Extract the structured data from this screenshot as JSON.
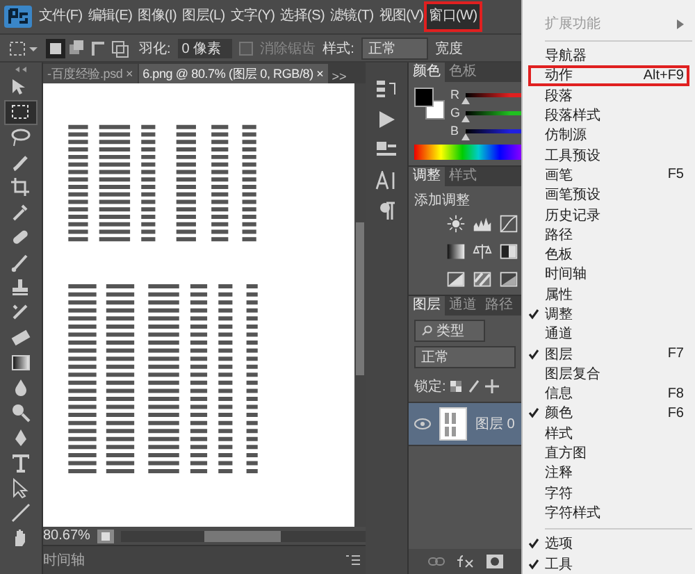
{
  "menubar": {
    "items": [
      {
        "label": "文件(F)",
        "selected": false
      },
      {
        "label": "编辑(E)",
        "selected": false
      },
      {
        "label": "图像(I)",
        "selected": false
      },
      {
        "label": "图层(L)",
        "selected": false
      },
      {
        "label": "文字(Y)",
        "selected": false
      },
      {
        "label": "选择(S)",
        "selected": false
      },
      {
        "label": "滤镜(T)",
        "selected": false
      },
      {
        "label": "视图(V)",
        "selected": false
      },
      {
        "label": "窗口(W)",
        "selected": true,
        "highlighted": true
      }
    ]
  },
  "options": {
    "feather_label": "羽化:",
    "feather_value": "0 像素",
    "antialias": {
      "label": "消除锯齿",
      "checked": false,
      "disabled": true
    },
    "style_label": "样式:",
    "style_value": "正常",
    "width_label": "宽度"
  },
  "tabs": [
    {
      "label": "-百度经验.psd",
      "close": "×",
      "selected": false
    },
    {
      "label": "6.png @ 80.7% (图层 0, RGB/8)",
      "close": "×",
      "selected": true
    }
  ],
  "tab_overflow": ">>",
  "status": {
    "zoom": "80.67%"
  },
  "timeline": {
    "label": "时间轴"
  },
  "color_panel": {
    "tabs": [
      {
        "label": "颜色",
        "selected": true
      },
      {
        "label": "色板",
        "selected": false
      }
    ],
    "sliders": [
      {
        "label": "R",
        "color": "#e02020",
        "level": 0
      },
      {
        "label": "G",
        "color": "#20c020",
        "level": 0
      },
      {
        "label": "B",
        "color": "#2020e0",
        "level": 0
      }
    ]
  },
  "adjust_panel": {
    "tabs": [
      {
        "label": "调整",
        "selected": true
      },
      {
        "label": "样式",
        "selected": false
      }
    ],
    "title": "添加调整"
  },
  "layers_panel": {
    "tabs": [
      {
        "label": "图层",
        "selected": true
      },
      {
        "label": "通道",
        "selected": false
      },
      {
        "label": "路径",
        "selected": false
      }
    ],
    "filter": "类型",
    "blend": "正常",
    "lock_label": "锁定:",
    "layers": [
      {
        "name": "图层 0",
        "visible": true,
        "selected": true
      }
    ]
  },
  "window_menu": {
    "items": [
      {
        "kind": "item",
        "label": "扩展功能",
        "disabled": true,
        "submenu": true,
        "checked": false
      },
      {
        "kind": "separator"
      },
      {
        "kind": "item",
        "label": "导航器",
        "checked": false
      },
      {
        "kind": "item",
        "label": "动作",
        "shortcut": "Alt+F9",
        "checked": false,
        "highlighted": true
      },
      {
        "kind": "item",
        "label": "段落",
        "checked": false
      },
      {
        "kind": "item",
        "label": "段落样式",
        "checked": false
      },
      {
        "kind": "item",
        "label": "仿制源",
        "checked": false
      },
      {
        "kind": "item",
        "label": "工具预设",
        "checked": false
      },
      {
        "kind": "item",
        "label": "画笔",
        "shortcut": "F5",
        "checked": false
      },
      {
        "kind": "item",
        "label": "画笔预设",
        "checked": false
      },
      {
        "kind": "item",
        "label": "历史记录",
        "checked": false
      },
      {
        "kind": "item",
        "label": "路径",
        "checked": false
      },
      {
        "kind": "item",
        "label": "色板",
        "checked": false
      },
      {
        "kind": "item",
        "label": "时间轴",
        "checked": false
      },
      {
        "kind": "item",
        "label": "属性",
        "checked": false
      },
      {
        "kind": "item",
        "label": "调整",
        "checked": true
      },
      {
        "kind": "item",
        "label": "通道",
        "checked": false
      },
      {
        "kind": "item",
        "label": "图层",
        "shortcut": "F7",
        "checked": true
      },
      {
        "kind": "item",
        "label": "图层复合",
        "checked": false
      },
      {
        "kind": "item",
        "label": "信息",
        "shortcut": "F8",
        "checked": false
      },
      {
        "kind": "item",
        "label": "颜色",
        "shortcut": "F6",
        "checked": true
      },
      {
        "kind": "item",
        "label": "样式",
        "checked": false
      },
      {
        "kind": "item",
        "label": "直方图",
        "checked": false
      },
      {
        "kind": "item",
        "label": "注释",
        "checked": false
      },
      {
        "kind": "item",
        "label": "字符",
        "checked": false
      },
      {
        "kind": "item",
        "label": "字符样式",
        "checked": false
      },
      {
        "kind": "separator"
      },
      {
        "kind": "item",
        "label": "选项",
        "checked": true
      },
      {
        "kind": "item",
        "label": "工具",
        "checked": true
      }
    ]
  }
}
